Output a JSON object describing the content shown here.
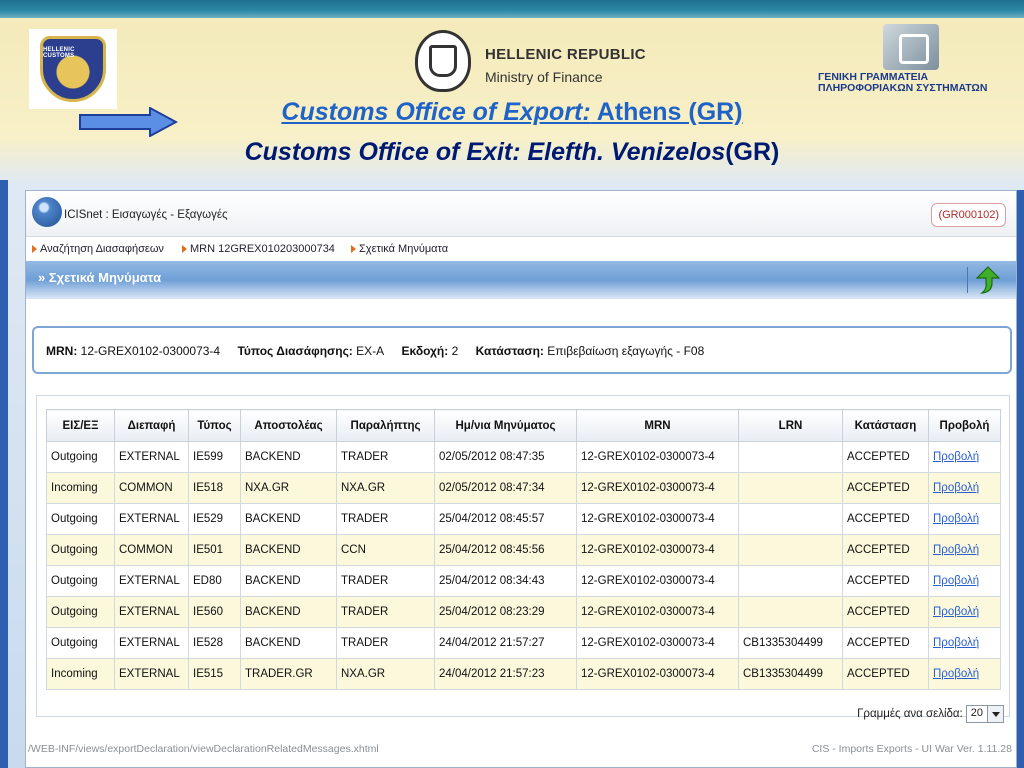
{
  "colors": {
    "headline_link": "#1f63c8",
    "headline_dark": "#001a72",
    "section_bar": "#6f9fd6",
    "row_alt": "#fbf8dc",
    "link": "#2a5fd0",
    "badge_text": "#b02a2a"
  },
  "banner": {
    "left_logo_text": "HELLENIC CUSTOMS",
    "republic_title": "HELLENIC REPUBLIC",
    "ministry": "Ministry of Finance",
    "gg_line1": "ΓΕΝΙΚΗ ΓΡΑΜΜΑΤΕΙΑ",
    "gg_line2": "ΠΛΗΡΟΦΟΡΙΑΚΩΝ ΣΥΣΤΗΜΑΤΩΝ",
    "line1_italic": "Customs Office of Export:",
    "line1_normal": " Athens (GR)",
    "line2_italic": "Customs Office of Exit: Elefth. Venizelos",
    "line2_normal": "(GR)"
  },
  "app": {
    "title": "ICISnet : Εισαγωγές - Εξαγωγές",
    "user_code": "(GR000102)",
    "breadcrumb": [
      "Αναζήτηση Διασαφήσεων",
      "MRN 12GREX010203000734",
      "Σχετικά Μηνύματα"
    ],
    "section_title": "» Σχετικά Μηνύματα",
    "icons": {
      "logo": "globe-icon",
      "back": "green-up-arrow-icon",
      "dropdown": "chevron-down-icon"
    }
  },
  "info": {
    "mrn_label": "MRN:",
    "mrn_value": "12-GREX0102-0300073-4",
    "type_label": "Τύπος Διασάφησης:",
    "type_value": "EX-A",
    "version_label": "Εκδοχή:",
    "version_value": "2",
    "status_label": "Κατάσταση:",
    "status_value": "Επιβεβαίωση εξαγωγής - F08"
  },
  "table": {
    "headers": [
      "ΕΙΣ/ΕΞ",
      "Διεπαφή",
      "Τύπος",
      "Αποστολέας",
      "Παραλήπτης",
      "Ημ/νια Μηνύματος",
      "MRN",
      "LRN",
      "Κατάσταση",
      "Προβολή"
    ],
    "rows": [
      [
        "Outgoing",
        "EXTERNAL",
        "IE599",
        "BACKEND",
        "TRADER",
        "02/05/2012 08:47:35",
        "12-GREX0102-0300073-4",
        "",
        "ACCEPTED",
        "Προβολή"
      ],
      [
        "Incoming",
        "COMMON",
        "IE518",
        "NXA.GR",
        "NXA.GR",
        "02/05/2012 08:47:34",
        "12-GREX0102-0300073-4",
        "",
        "ACCEPTED",
        "Προβολή"
      ],
      [
        "Outgoing",
        "EXTERNAL",
        "IE529",
        "BACKEND",
        "TRADER",
        "25/04/2012 08:45:57",
        "12-GREX0102-0300073-4",
        "",
        "ACCEPTED",
        "Προβολή"
      ],
      [
        "Outgoing",
        "COMMON",
        "IE501",
        "BACKEND",
        "CCN",
        "25/04/2012 08:45:56",
        "12-GREX0102-0300073-4",
        "",
        "ACCEPTED",
        "Προβολή"
      ],
      [
        "Outgoing",
        "EXTERNAL",
        "ED80",
        "BACKEND",
        "TRADER",
        "25/04/2012 08:34:43",
        "12-GREX0102-0300073-4",
        "",
        "ACCEPTED",
        "Προβολή"
      ],
      [
        "Outgoing",
        "EXTERNAL",
        "IE560",
        "BACKEND",
        "TRADER",
        "25/04/2012 08:23:29",
        "12-GREX0102-0300073-4",
        "",
        "ACCEPTED",
        "Προβολή"
      ],
      [
        "Outgoing",
        "EXTERNAL",
        "IE528",
        "BACKEND",
        "TRADER",
        "24/04/2012 21:57:27",
        "12-GREX0102-0300073-4",
        "CB1335304499",
        "ACCEPTED",
        "Προβολή"
      ],
      [
        "Incoming",
        "EXTERNAL",
        "IE515",
        "TRADER.GR",
        "NXA.GR",
        "24/04/2012 21:57:23",
        "12-GREX0102-0300073-4",
        "CB1335304499",
        "ACCEPTED",
        "Προβολή"
      ]
    ]
  },
  "pager": {
    "label": "Γραμμές ανα σελίδα:",
    "value": "20"
  },
  "footer": {
    "path": "/WEB-INF/views/exportDeclaration/viewDeclarationRelatedMessages.xhtml",
    "version": "CIS - Imports Exports - UI War Ver. 1.11.28"
  }
}
